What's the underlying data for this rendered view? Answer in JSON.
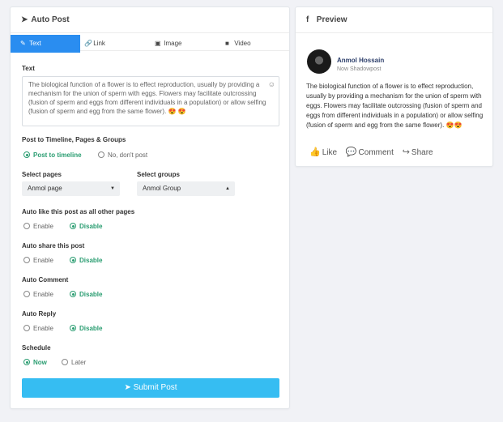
{
  "left_panel": {
    "title": "Auto Post",
    "title_icon": "paper-plane-icon",
    "tabs": [
      {
        "label": "Text",
        "icon": "pencil-square-icon"
      },
      {
        "label": "Link",
        "icon": "link-icon"
      },
      {
        "label": "Image",
        "icon": "image-icon"
      },
      {
        "label": "Video",
        "icon": "video-camera-icon"
      }
    ],
    "text_label": "Text",
    "text_value": "The biological function of a flower is to effect reproduction, usually by providing a mechanism for the union of sperm with eggs. Flowers may facilitate outcrossing (fusion of sperm and eggs from different individuals in a population) or allow selfing (fusion of sperm and egg from the same flower). 😍 😍",
    "post_to_label": "Post to Timeline, Pages & Groups",
    "post_to_options": [
      "Post to timeline",
      "No, don't post"
    ],
    "post_to_selected": "Post to timeline",
    "select_pages_label": "Select pages",
    "select_pages_value": "Anmol page",
    "select_groups_label": "Select groups",
    "select_groups_value": "Anmol Group",
    "auto_like_label": "Auto like this post as all other pages",
    "auto_share_label": "Auto share this post",
    "auto_comment_label": "Auto Comment",
    "auto_reply_label": "Auto Reply",
    "enable_label": "Enable",
    "disable_label": "Disable",
    "schedule_label": "Schedule",
    "schedule_options": [
      "Now",
      "Later"
    ],
    "schedule_selected": "Now",
    "submit_label": "Submit Post"
  },
  "right_panel": {
    "title": "Preview",
    "title_icon": "facebook-icon",
    "author_name": "Anmol Hossain",
    "author_sub": "Now Shadowpost",
    "post_text": "The biological function of a flower is to effect reproduction, usually by providing a mechanism for the union of sperm with eggs. Flowers may facilitate outcrossing (fusion of sperm and eggs from different individuals in a population) or allow selfing (fusion of sperm and egg from the same flower). 😍😍",
    "actions": [
      "Like",
      "Comment",
      "Share"
    ]
  },
  "colors": {
    "accent": "#2a8df0",
    "checked": "#2a9d71",
    "submit": "#36bdf2",
    "author": "#2c3e6a"
  }
}
